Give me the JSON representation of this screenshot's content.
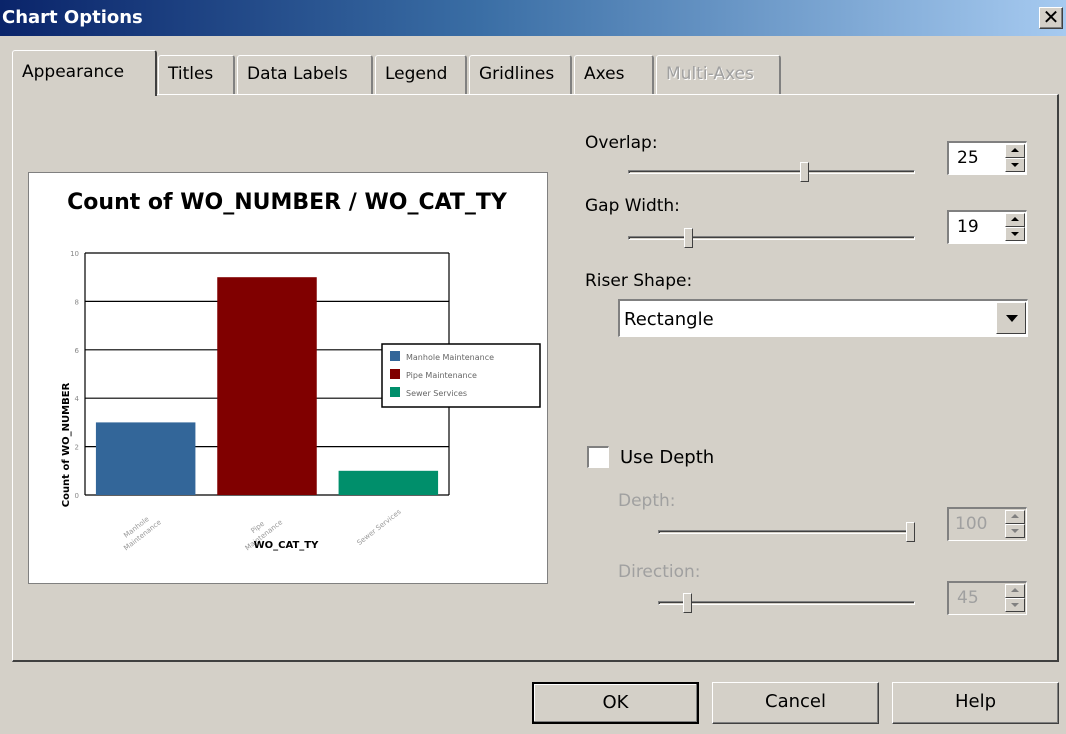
{
  "window": {
    "title": "Chart Options",
    "close_symbol": "✕"
  },
  "tabs": [
    {
      "label": "Appearance",
      "active": true,
      "enabled": true
    },
    {
      "label": "Titles",
      "active": false,
      "enabled": true
    },
    {
      "label": "Data Labels",
      "active": false,
      "enabled": true
    },
    {
      "label": "Legend",
      "active": false,
      "enabled": true
    },
    {
      "label": "Gridlines",
      "active": false,
      "enabled": true
    },
    {
      "label": "Axes",
      "active": false,
      "enabled": true
    },
    {
      "label": "Multi-Axes",
      "active": false,
      "enabled": false
    }
  ],
  "settings": {
    "overlap": {
      "label": "Overlap:",
      "value": "25",
      "fraction": 0.62
    },
    "gap_width": {
      "label": "Gap Width:",
      "value": "19",
      "fraction": 0.2
    },
    "riser_shape": {
      "label": "Riser Shape:",
      "value": "Rectangle"
    },
    "use_depth": {
      "label": "Use Depth",
      "checked": false
    },
    "depth": {
      "label": "Depth:",
      "value": "100",
      "fraction": 1.0
    },
    "direction": {
      "label": "Direction:",
      "value": "45",
      "fraction": 0.1
    }
  },
  "buttons": {
    "ok": "OK",
    "cancel": "Cancel",
    "help": "Help"
  },
  "chart_data": {
    "type": "bar",
    "title": "Count of WO_NUMBER / WO_CAT_TY",
    "xlabel": "WO_CAT_TY",
    "ylabel": "Count of WO_NUMBER",
    "ylim": [
      0,
      10
    ],
    "yticks": [
      "0",
      "2",
      "4",
      "6",
      "8",
      "10"
    ],
    "categories": [
      "Manhole Maintenance",
      "Pipe Maintenance",
      "Sewer Services"
    ],
    "category_tick_labels": [
      [
        "Manhole",
        "Maintenance"
      ],
      [
        "Pipe",
        "Maintenance"
      ],
      [
        "Sewer Services"
      ]
    ],
    "values": [
      3,
      9,
      1
    ],
    "colors": [
      "#336699",
      "#800000",
      "#008f6b"
    ],
    "legend": {
      "entries": [
        "Manhole Maintenance",
        "Pipe Maintenance",
        "Sewer Services"
      ],
      "placement": "right"
    },
    "grid": true
  }
}
